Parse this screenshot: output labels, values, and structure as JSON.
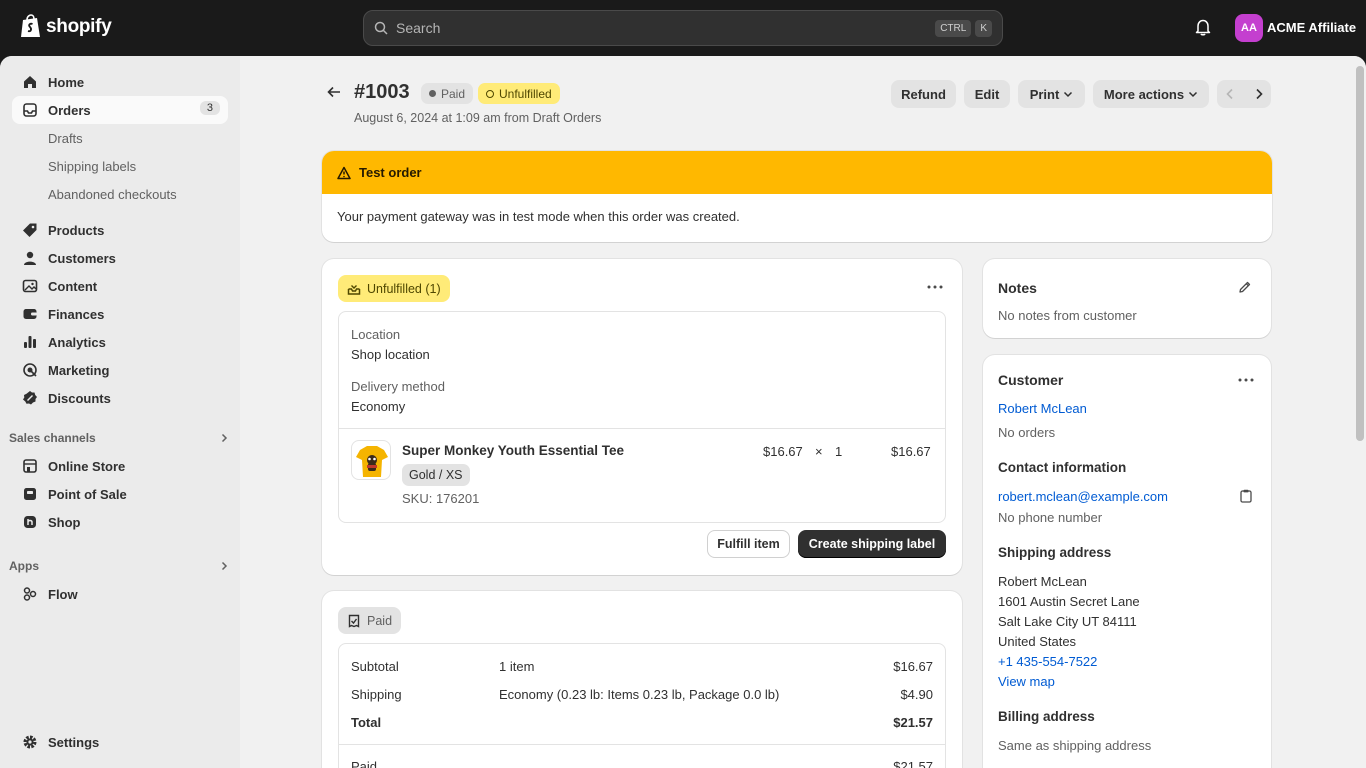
{
  "topbar": {
    "brand": "shopify",
    "search_placeholder": "Search",
    "shortcut_ctrl": "CTRL",
    "shortcut_k": "K",
    "avatar_initials": "AA",
    "store_name": "ACME Affiliate",
    "avatar_color": "#c43fcf"
  },
  "sidebar": {
    "home": "Home",
    "orders": "Orders",
    "orders_count": "3",
    "drafts": "Drafts",
    "shipping_labels": "Shipping labels",
    "abandoned": "Abandoned checkouts",
    "products": "Products",
    "customers": "Customers",
    "content": "Content",
    "finances": "Finances",
    "analytics": "Analytics",
    "marketing": "Marketing",
    "discounts": "Discounts",
    "sales_channels": "Sales channels",
    "online_store": "Online Store",
    "pos": "Point of Sale",
    "shop": "Shop",
    "apps": "Apps",
    "flow": "Flow",
    "settings": "Settings"
  },
  "header": {
    "order_number": "#1003",
    "paid_badge": "Paid",
    "unfulfilled_badge": "Unfulfilled",
    "subtitle": "August 6, 2024 at 1:09 am from Draft Orders",
    "refund": "Refund",
    "edit": "Edit",
    "print": "Print",
    "more_actions": "More actions"
  },
  "banner": {
    "title": "Test order",
    "body": "Your payment gateway was in test mode when this order was created.",
    "color": "#ffb800"
  },
  "fulfillment": {
    "status": "Unfulfilled (1)",
    "location_label": "Location",
    "location_value": "Shop location",
    "delivery_label": "Delivery method",
    "delivery_value": "Economy",
    "item_name": "Super Monkey Youth Essential Tee",
    "variant": "Gold / XS",
    "sku": "SKU: 176201",
    "unit_price": "$16.67",
    "times": "×",
    "quantity": "1",
    "line_total": "$16.67",
    "fulfill_btn": "Fulfill item",
    "shipping_label_btn": "Create shipping label"
  },
  "payment": {
    "status": "Paid",
    "rows": [
      {
        "label": "Subtotal",
        "detail": "1 item",
        "amount": "$16.67"
      },
      {
        "label": "Shipping",
        "detail": "Economy (0.23 lb: Items 0.23 lb, Package 0.0 lb)",
        "amount": "$4.90"
      },
      {
        "label": "Total",
        "detail": "",
        "amount": "$21.57"
      }
    ],
    "paid_label": "Paid",
    "paid_amount": "$21.57"
  },
  "notes": {
    "title": "Notes",
    "body": "No notes from customer"
  },
  "customer": {
    "title": "Customer",
    "name": "Robert McLean",
    "orders": "No orders",
    "contact_title": "Contact information",
    "email": "robert.mclean@example.com",
    "phone_none": "No phone number",
    "shipping_title": "Shipping address",
    "addr_name": "Robert McLean",
    "addr_line1": "1601 Austin Secret Lane",
    "addr_line2": "Salt Lake City UT 84111",
    "addr_country": "United States",
    "addr_phone": "+1 435-554-7522",
    "view_map": "View map",
    "billing_title": "Billing address",
    "billing_body": "Same as shipping address"
  }
}
